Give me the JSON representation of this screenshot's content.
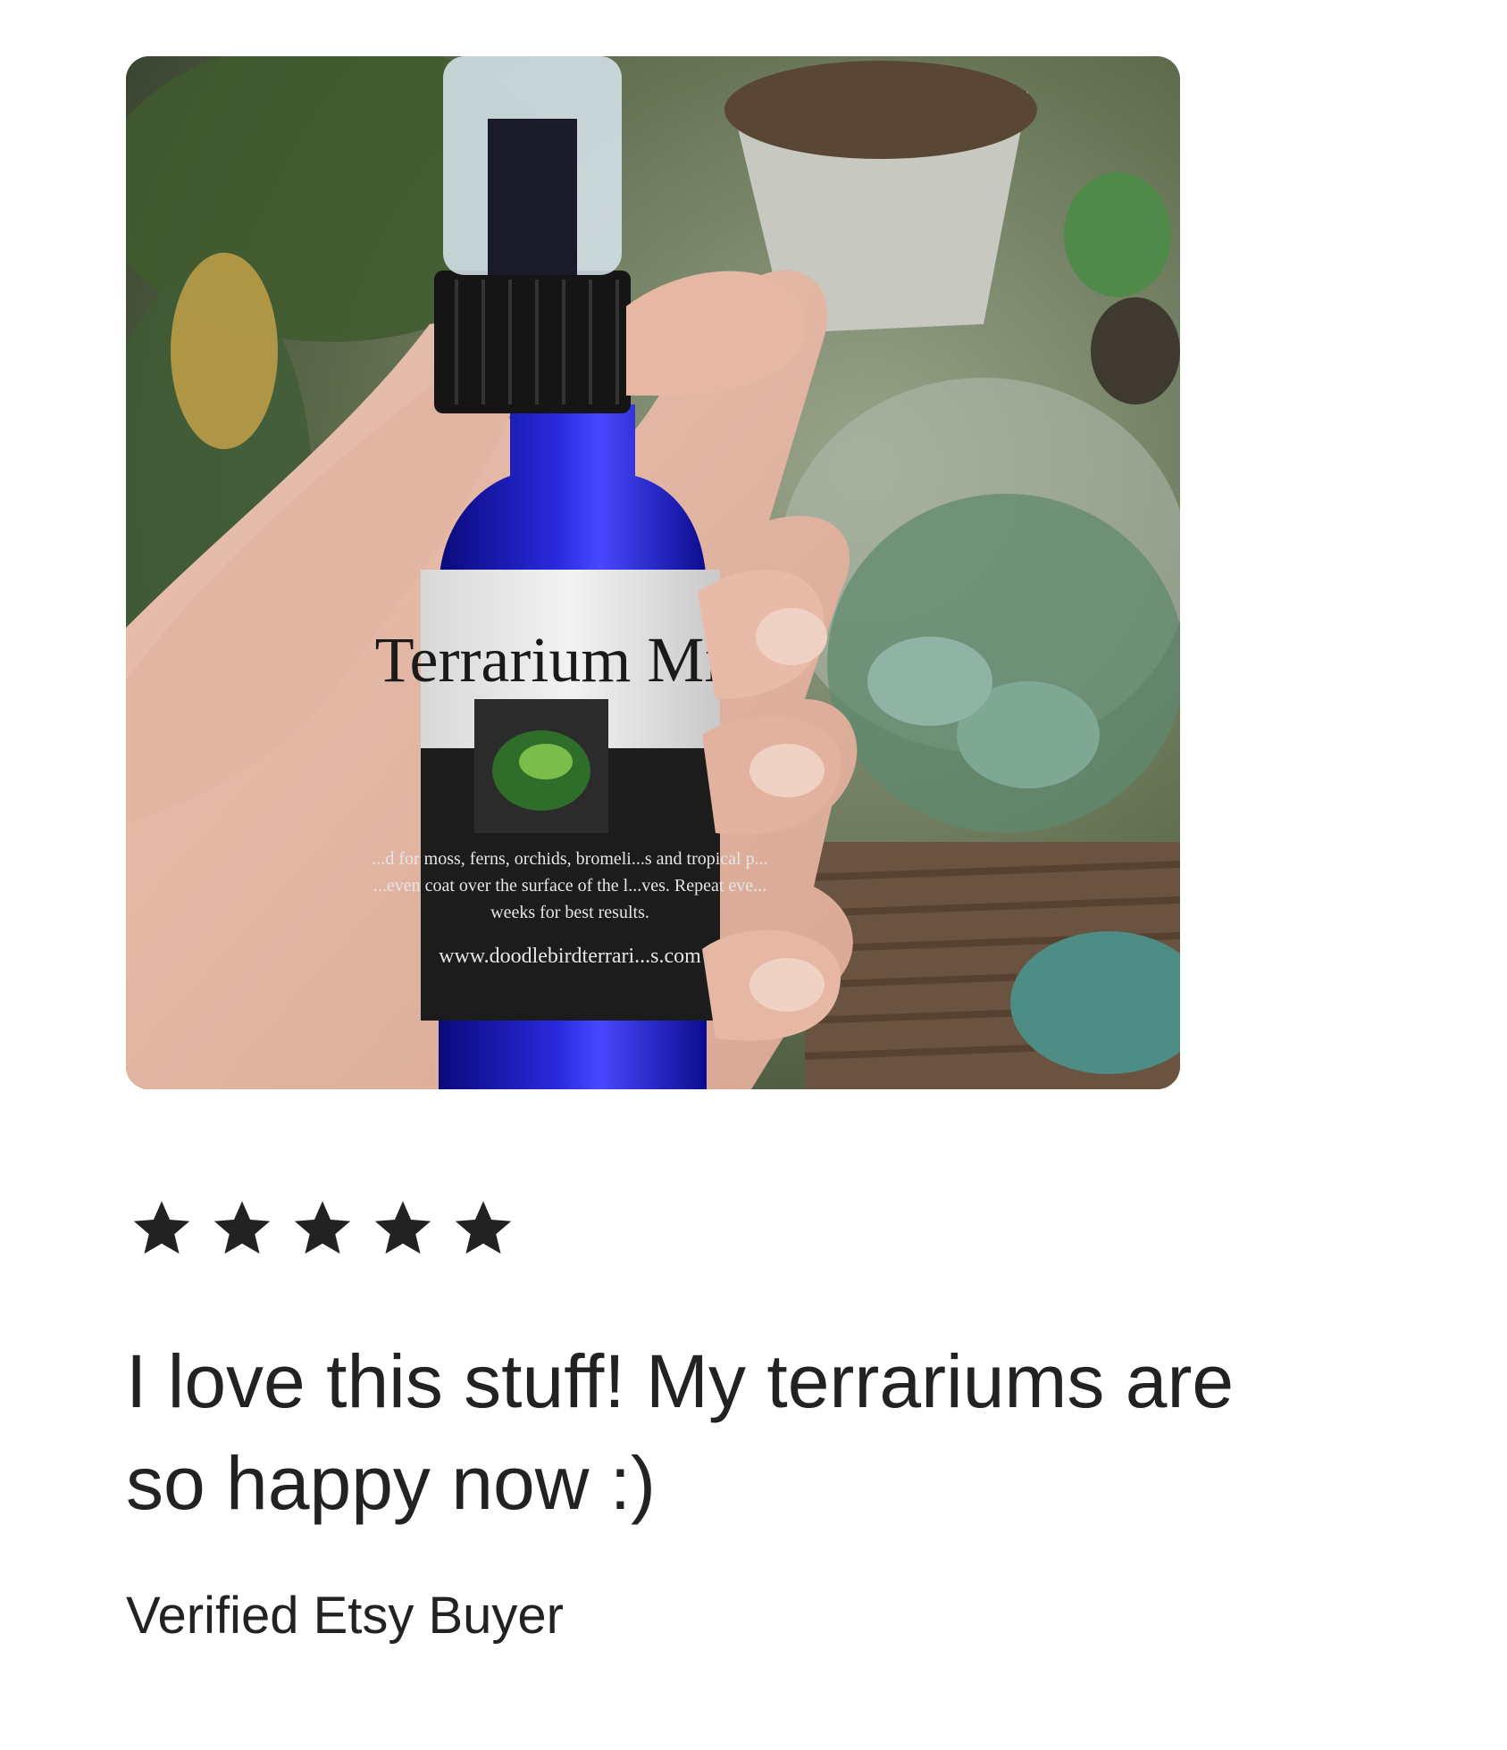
{
  "review": {
    "rating": 5,
    "rating_max": 5,
    "text": "I love this stuff!  My terrariums are so happy now :)",
    "author": "Verified Etsy Buyer"
  },
  "photo": {
    "label_title": "Terrarium Mist",
    "label_body_line1": "...d for moss, ferns, orchids, bromeli...s and tropical p...",
    "label_body_line2": "...even coat over the surface of the l...ves. Repeat eve...",
    "label_body_line3": "weeks for best results.",
    "label_url": "www.doodlebirdterrari...s.com"
  },
  "colors": {
    "text": "#222222",
    "star": "#222222",
    "background": "#ffffff"
  },
  "icons": {
    "star": "star-icon"
  }
}
